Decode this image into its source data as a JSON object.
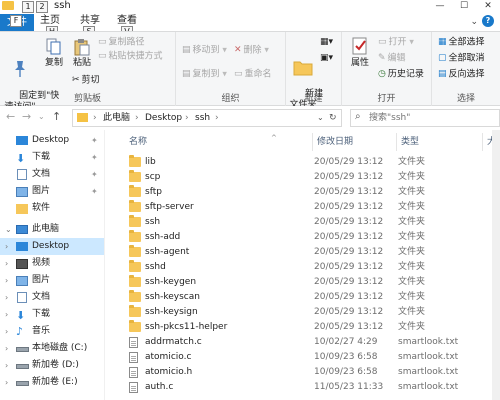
{
  "window": {
    "title": "ssh",
    "minimize": "—",
    "maximize": "☐",
    "close": "✕"
  },
  "keytips": {
    "qat": [
      "1",
      "2"
    ],
    "file": "F",
    "home": "H",
    "share": "S",
    "view": "V"
  },
  "tabs": {
    "file": "文件",
    "home": "主页",
    "share": "共享",
    "view": "查看"
  },
  "ribbon": {
    "clipboard": {
      "label": "剪贴板",
      "pin": "固定到\"快\n速访问\"",
      "copy": "复制",
      "paste": "粘贴",
      "copy_path": "复制路径",
      "paste_shortcut": "粘贴快捷方式",
      "cut": "剪切"
    },
    "organize": {
      "label": "组织",
      "move_to": "移动到",
      "copy_to": "复制到",
      "delete": "删除",
      "rename": "重命名"
    },
    "new": {
      "label": "新建",
      "new_folder": "新建\n文件夹"
    },
    "open": {
      "label": "打开",
      "properties": "属性",
      "open": "打开",
      "edit": "编辑",
      "history": "历史记录"
    },
    "select": {
      "label": "选择",
      "select_all": "全部选择",
      "select_none": "全部取消",
      "invert": "反向选择"
    }
  },
  "address": {
    "crumbs": [
      "此电脑",
      "Desktop",
      "ssh"
    ],
    "search_placeholder": "搜索\"ssh\""
  },
  "navpane": {
    "quick_access": [
      {
        "label": "Desktop",
        "pinned": true
      },
      {
        "label": "下载",
        "pinned": true
      },
      {
        "label": "文档",
        "pinned": true
      },
      {
        "label": "图片",
        "pinned": true
      },
      {
        "label": "软件",
        "pinned": false
      }
    ],
    "this_pc": "此电脑",
    "pc_items": [
      {
        "label": "Desktop",
        "selected": true
      },
      {
        "label": "视频"
      },
      {
        "label": "图片"
      },
      {
        "label": "文档"
      },
      {
        "label": "下载"
      },
      {
        "label": "音乐"
      },
      {
        "label": "本地磁盘 (C:)"
      },
      {
        "label": "新加卷 (D:)"
      },
      {
        "label": "新加卷 (E:)"
      }
    ]
  },
  "filelist": {
    "columns": [
      "名称",
      "修改日期",
      "类型",
      "大"
    ],
    "rows": [
      {
        "name": "lib",
        "date": "20/05/29 13:12",
        "type": "文件夹",
        "kind": "folder"
      },
      {
        "name": "scp",
        "date": "20/05/29 13:12",
        "type": "文件夹",
        "kind": "folder"
      },
      {
        "name": "sftp",
        "date": "20/05/29 13:12",
        "type": "文件夹",
        "kind": "folder"
      },
      {
        "name": "sftp-server",
        "date": "20/05/29 13:12",
        "type": "文件夹",
        "kind": "folder"
      },
      {
        "name": "ssh",
        "date": "20/05/29 13:12",
        "type": "文件夹",
        "kind": "folder"
      },
      {
        "name": "ssh-add",
        "date": "20/05/29 13:12",
        "type": "文件夹",
        "kind": "folder"
      },
      {
        "name": "ssh-agent",
        "date": "20/05/29 13:12",
        "type": "文件夹",
        "kind": "folder"
      },
      {
        "name": "sshd",
        "date": "20/05/29 13:12",
        "type": "文件夹",
        "kind": "folder"
      },
      {
        "name": "ssh-keygen",
        "date": "20/05/29 13:12",
        "type": "文件夹",
        "kind": "folder"
      },
      {
        "name": "ssh-keyscan",
        "date": "20/05/29 13:12",
        "type": "文件夹",
        "kind": "folder"
      },
      {
        "name": "ssh-keysign",
        "date": "20/05/29 13:12",
        "type": "文件夹",
        "kind": "folder"
      },
      {
        "name": "ssh-pkcs11-helper",
        "date": "20/05/29 13:12",
        "type": "文件夹",
        "kind": "folder"
      },
      {
        "name": "addrmatch.c",
        "date": "10/02/27 4:29",
        "type": "smartlook.txt",
        "kind": "file"
      },
      {
        "name": "atomicio.c",
        "date": "10/09/23 6:58",
        "type": "smartlook.txt",
        "kind": "file"
      },
      {
        "name": "atomicio.h",
        "date": "10/09/23 6:58",
        "type": "smartlook.txt",
        "kind": "file"
      },
      {
        "name": "auth.c",
        "date": "11/05/23 11:33",
        "type": "smartlook.txt",
        "kind": "file"
      }
    ]
  },
  "colors": {
    "accent": "#1979ca",
    "selected": "#cce8ff",
    "folder": "#f6c75a"
  }
}
